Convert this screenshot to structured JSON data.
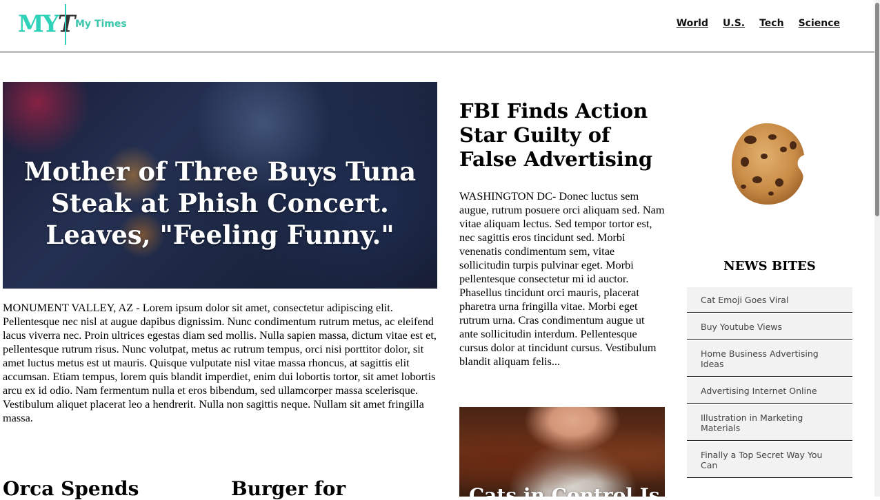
{
  "header": {
    "logo_text": "MYT",
    "site_name": "My Times",
    "nav": [
      {
        "label": "World"
      },
      {
        "label": "U.S."
      },
      {
        "label": "Tech"
      },
      {
        "label": "Science"
      }
    ]
  },
  "hero": {
    "title": "Mother of Three Buys Tuna Steak at Phish Concert. Leaves, \"Feeling Funny.\"",
    "body": "MONUMENT VALLEY, AZ - Lorem ipsum dolor sit amet, consectetur adipiscing elit. Pellentesque nec nisl at augue dapibus dignissim. Nunc condimentum rutrum metus, ac eleifend lacus viverra nec. Proin ultrices egestas diam sed mollis. Nulla sapien massa, dictum vitae est et, pellentesque rutrum risus. Nunc volutpat, metus ac rutrum tempus, orci nisi porttitor dolor, sit amet luctus metus est ut mauris. Quisque vulputate nisl vitae massa rhoncus, at sagittis elit accumsan. Etiam tempus, lorem quis blandit imperdiet, enim dui lobortis tortor, sit amet lobortis arcu ex id odio. Nam fermentum nulla et eros bibendum, sed ullamcorper massa scelerisque. Vestibulum aliquet placerat leo a hendrerit. Nulla non sagittis neque. Nullam sit amet fringilla massa."
  },
  "lower_articles": [
    {
      "title": "Orca Spends"
    },
    {
      "title": "Burger for"
    }
  ],
  "feature": {
    "title": "FBI Finds Action Star Guilty of False Advertising",
    "body": "WASHINGTON DC- Donec luctus sem augue, rutrum posuere orci aliquam sed. Nam vitae aliquam lectus. Sed tempor tortor est, nec sagittis eros tincidunt sed. Morbi venenatis condimentum sem, vitae sollicitudin turpis pulvinar eget. Morbi pellentesque consectetur mi id auctor. Phasellus tincidunt orci mauris, placerat pharetra urna fringilla vitae. Morbi eget rutrum urna. Cras condimentum augue ut ante sollicitudin interdum. Pellentesque cursus dolor at tincidunt cursus. Vestibulum blandit aliquam felis..."
  },
  "cat_story": {
    "title": "Cats in Control Is"
  },
  "news_bites": {
    "heading": "NEWS BITES",
    "items": [
      {
        "label": "Cat Emoji Goes Viral"
      },
      {
        "label": "Buy Youtube Views"
      },
      {
        "label": "Home Business Advertising Ideas"
      },
      {
        "label": "Advertising Internet Online"
      },
      {
        "label": "Illustration in Marketing Materials"
      },
      {
        "label": "Finally a Top Secret Way You Can"
      }
    ]
  },
  "colors": {
    "brand_teal": "#2fd2b8",
    "nav_text": "#111111",
    "bite_bg": "#f2f2f2"
  }
}
